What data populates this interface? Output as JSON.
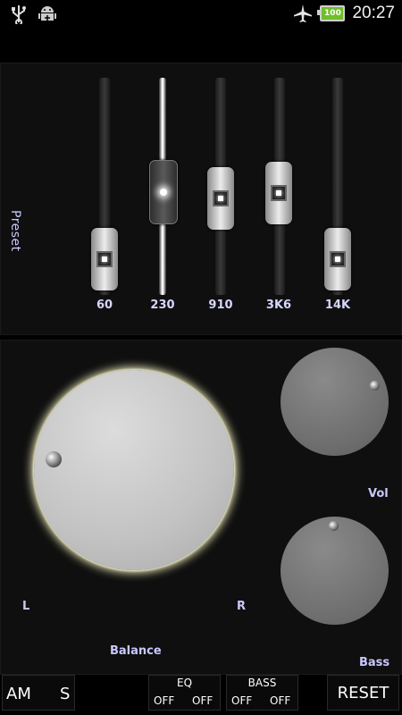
{
  "statusbar": {
    "icons": [
      "usb-icon",
      "android-debug-icon",
      "airplane-icon",
      "battery-icon"
    ],
    "battery_level": "100",
    "time": "20:27"
  },
  "eq": {
    "preset_label": "Preset",
    "bands": [
      {
        "label": "60",
        "level": 0.18
      },
      {
        "label": "230",
        "level": 0.62
      },
      {
        "label": "910",
        "level": 0.5
      },
      {
        "label": "3K6",
        "level": 0.53
      },
      {
        "label": "14K",
        "level": 0.18
      }
    ]
  },
  "knobs": {
    "balance_label": "Balance",
    "left_label": "L",
    "right_label": "R",
    "vol_label": "Vol",
    "bass_label": "Bass"
  },
  "bottom": {
    "am_label": "AM",
    "s_label": "S",
    "eq_title": "EQ",
    "eq_off1": "OFF",
    "eq_off2": "OFF",
    "bass_title": "BASS",
    "bass_off1": "OFF",
    "bass_off2": "OFF",
    "reset_label": "RESET"
  },
  "colors": {
    "label_accent": "#c8c8ff",
    "battery": "#6fbf2a",
    "balance_glow": "#e9e6b4"
  }
}
